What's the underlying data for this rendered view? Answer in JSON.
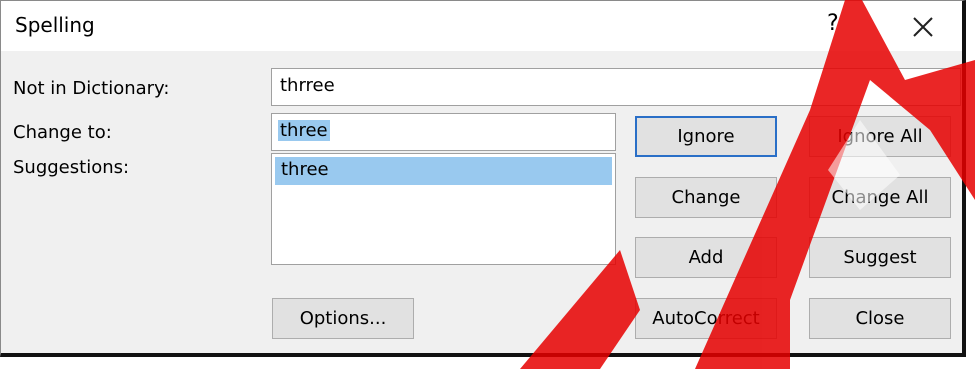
{
  "dialog": {
    "title": "Spelling",
    "help": "?"
  },
  "labels": {
    "not_in_dictionary": "Not in Dictionary:",
    "change_to": "Change to:",
    "suggestions": "Suggestions:"
  },
  "fields": {
    "not_in_dictionary_value": "thrree",
    "change_to_value": "three"
  },
  "suggestions": [
    "three"
  ],
  "buttons": {
    "options": "Options...",
    "ignore": "Ignore",
    "ignore_all": "Ignore All",
    "change": "Change",
    "change_all": "Change All",
    "add": "Add",
    "suggest": "Suggest",
    "autocorrect": "AutoCorrect",
    "close": "Close"
  },
  "colors": {
    "dialog_bg": "#f0f0f0",
    "selection": "#99c9ef",
    "default_button_border": "#2a6fc7",
    "watermark": "#e60000"
  },
  "icons": {
    "close": "close-icon"
  }
}
